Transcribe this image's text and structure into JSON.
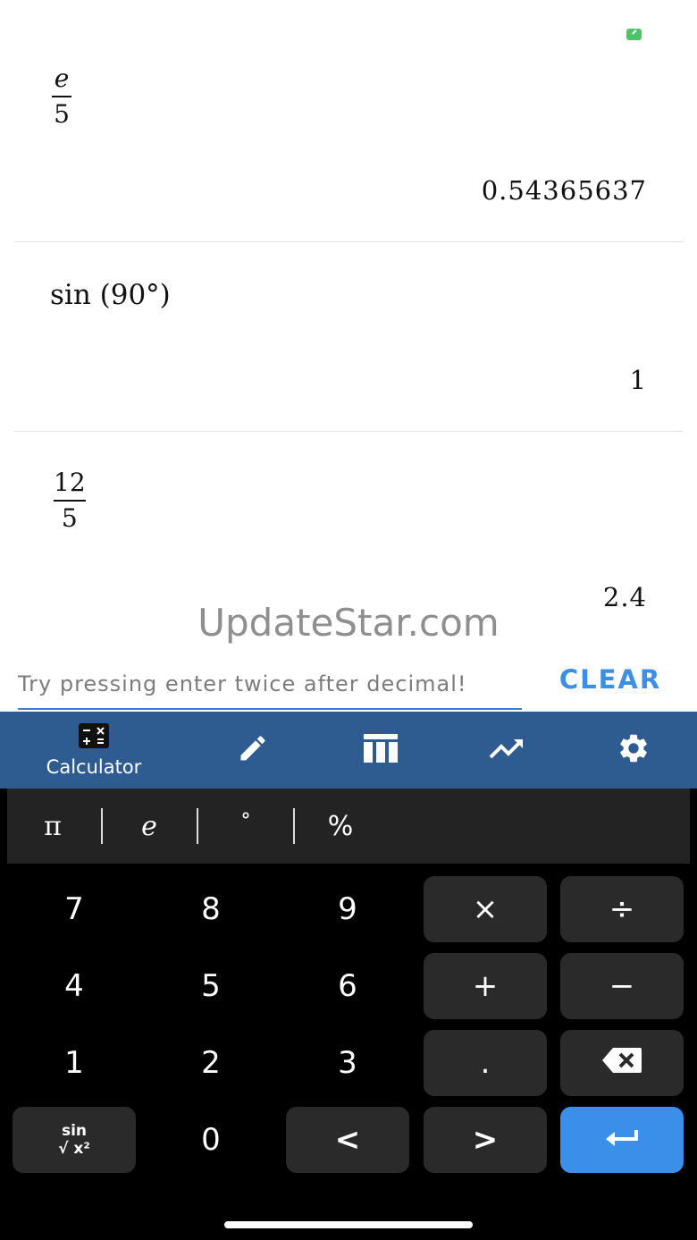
{
  "history": [
    {
      "expr_num": "e",
      "expr_den": "5",
      "result": "0.54365637"
    },
    {
      "expr_text": "sin (90°)",
      "result": "1"
    },
    {
      "expr_num": "12",
      "expr_den": "5",
      "result": "2.4"
    }
  ],
  "watermark": "UpdateStar.com",
  "input": {
    "placeholder": "Try pressing enter twice after decimal!",
    "value": ""
  },
  "clear_label": "CLEAR",
  "nav": {
    "calculator_label": "Calculator"
  },
  "symbols": {
    "pi": "π",
    "e": "e",
    "degree": "°",
    "percent": "%"
  },
  "keys": {
    "seven": "7",
    "eight": "8",
    "nine": "9",
    "multiply": "×",
    "divide": "÷",
    "four": "4",
    "five": "5",
    "six": "6",
    "plus": "+",
    "minus": "−",
    "one": "1",
    "two": "2",
    "three": "3",
    "dot": ".",
    "func_top": "sin",
    "func_bottom": "√ x²",
    "zero": "0",
    "left": "<",
    "right": ">"
  },
  "colors": {
    "accent": "#3a8fe8",
    "nav_bg": "#2e5c90",
    "key_bg": "#2a2a2a",
    "status": "#4cc469"
  },
  "icons": [
    "calculator-icon",
    "pencil-icon",
    "table-icon",
    "trending-icon",
    "gear-icon",
    "backspace-icon",
    "enter-icon"
  ]
}
